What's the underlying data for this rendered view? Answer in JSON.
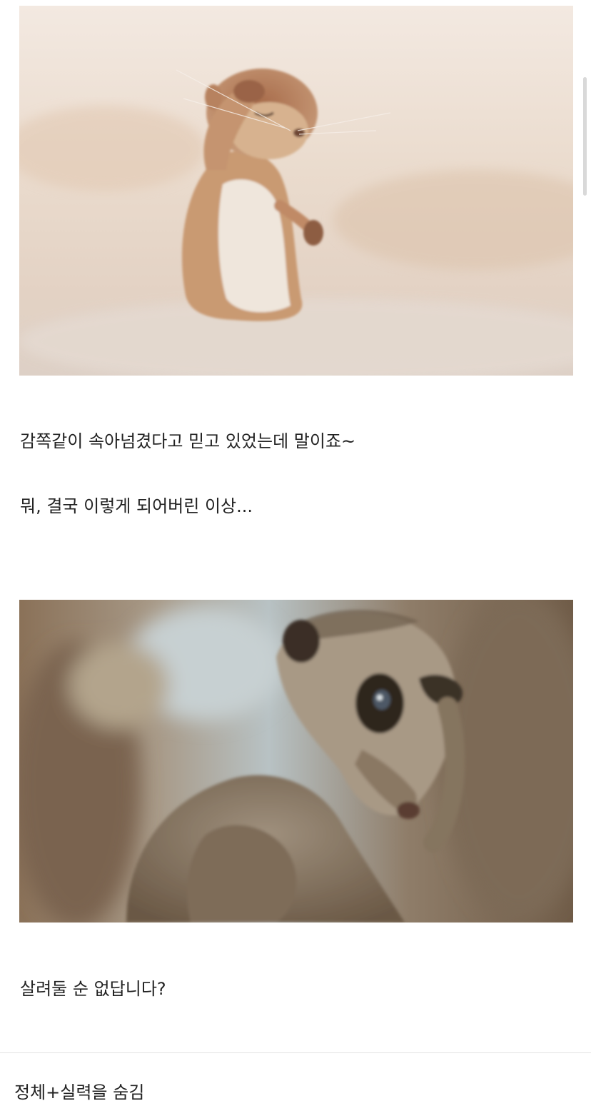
{
  "post": {
    "paragraphs": [
      "감쪽같이 속아넘겼다고 믿고 있었는데 말이죠~",
      "뭐, 결국 이렇게 되어버린 이상...",
      "살려둘 순 없답니다?"
    ]
  },
  "footer": {
    "title": "정체+실력을 숨김"
  },
  "colors": {
    "text": "#222222",
    "divider": "#e2e2e2",
    "scrollbar": "#d9d9d9"
  }
}
